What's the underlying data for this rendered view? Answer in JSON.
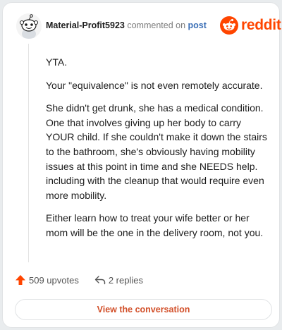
{
  "comment": {
    "username": "Material-Profit5923",
    "commented_on_text": "commented on",
    "post_link_text": "post",
    "body": [
      "YTA.",
      "Your \"equivalence\" is not even remotely accurate.",
      "She didn't get drunk, she has a medical condition. One that involves giving up her body to carry YOUR child. If she couldn't make it down the stairs to the bathroom, she's obviously having mobility issues at this point in time and she NEEDS help. including with the cleanup that would require even more mobility.",
      "Either learn how to treat your wife better or her mom will be the one in the delivery room, not you."
    ],
    "upvotes_label": "509 upvotes",
    "replies_label": "2 replies"
  },
  "brand": {
    "name": "reddit",
    "icon": "reddit-snoo-icon",
    "color": "#ff4500"
  },
  "actions": {
    "upvote_icon": "upvote-arrow-icon",
    "reply_icon": "reply-arrow-icon",
    "upvote_color": "#ff4500",
    "view_conversation_label": "View the conversation"
  }
}
